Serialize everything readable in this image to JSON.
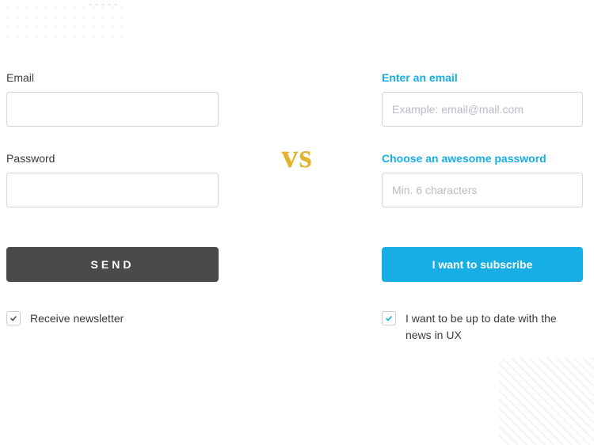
{
  "vs_text": "vs",
  "left": {
    "email_label": "Email",
    "email_value": "",
    "password_label": "Password",
    "password_value": "",
    "button_label": "SEND",
    "checkbox_label": "Receive newsletter",
    "checkbox_checked": true
  },
  "right": {
    "email_label": "Enter an email",
    "email_placeholder": "Example: email@mail.com",
    "email_value": "",
    "password_label": "Choose an awesome password",
    "password_placeholder": "Min. 6 characters",
    "password_value": "",
    "button_label": "I want to subscribe",
    "checkbox_label": "I want to be up to date with the news in UX",
    "checkbox_checked": true
  }
}
